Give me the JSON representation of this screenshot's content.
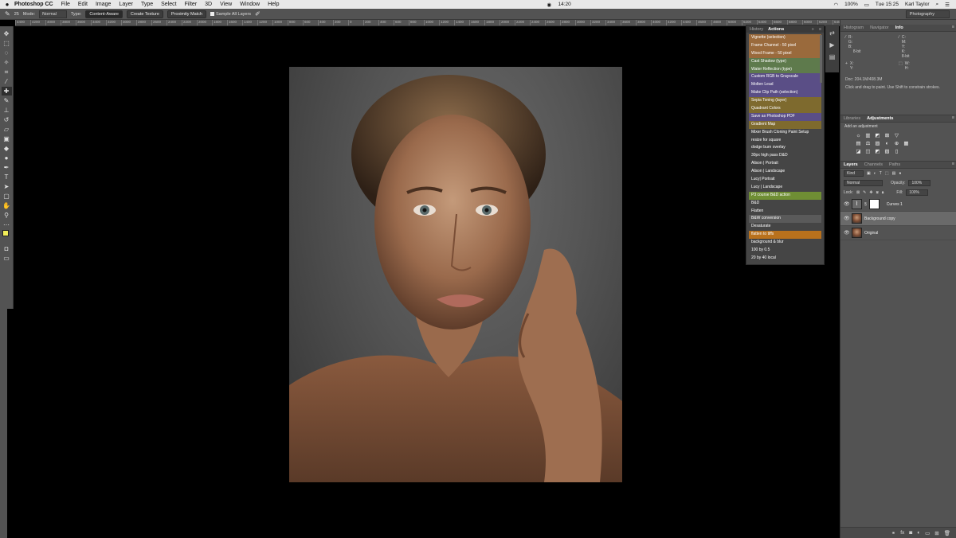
{
  "menubar": {
    "apple": "",
    "app_name": "Photoshop CC",
    "items": [
      "File",
      "Edit",
      "Image",
      "Layer",
      "Type",
      "Select",
      "Filter",
      "3D",
      "View",
      "Window",
      "Help"
    ],
    "time_center": "14:20",
    "battery": "100%",
    "clock": "Tue 15:25",
    "user": "Karl Taylor"
  },
  "options_bar": {
    "brush_size": "25",
    "mode_label": "Mode:",
    "mode_value": "Normal",
    "type_label": "Type:",
    "type_options": [
      "Content-Aware",
      "Create Texture",
      "Proximity Match"
    ],
    "sample_all_layers": "Sample All Layers",
    "workspace": "Photography"
  },
  "ruler": {
    "ticks": [
      "4400",
      "4200",
      "4000",
      "3800",
      "3600",
      "3400",
      "3200",
      "3000",
      "2800",
      "2600",
      "2400",
      "2200",
      "2000",
      "1800",
      "1600",
      "1400",
      "1200",
      "1000",
      "800",
      "600",
      "400",
      "200",
      "0",
      "200",
      "400",
      "600",
      "800",
      "1000",
      "1200",
      "1400",
      "1600",
      "1800",
      "2000",
      "2200",
      "2400",
      "2600",
      "2800",
      "3000",
      "3200",
      "3400",
      "3600",
      "3800",
      "4000",
      "4200",
      "4400",
      "4600",
      "4800",
      "5000",
      "5200",
      "5400",
      "5600",
      "5800",
      "6000",
      "6200",
      "6400",
      "6600",
      "6800",
      "7000",
      "7200"
    ]
  },
  "actions_panel": {
    "tabs": [
      "History",
      "Actions"
    ],
    "items": [
      {
        "label": "Vignette (selection)",
        "color": "#9a6a3c"
      },
      {
        "label": "Frame Channel - 50 pixel",
        "color": "#9a6a3c"
      },
      {
        "label": "Wood Frame - 50 pixel",
        "color": "#9a6a3c"
      },
      {
        "label": "Cast Shadow (type)",
        "color": "#5e7a4c"
      },
      {
        "label": "Water Reflection (type)",
        "color": "#5e7a4c"
      },
      {
        "label": "Custom RGB to Grayscale",
        "color": "#5a4e86"
      },
      {
        "label": "Molten Lead",
        "color": "#5a4e86"
      },
      {
        "label": "Make Clip Path (selection)",
        "color": "#5a4e86"
      },
      {
        "label": "Sepia Toning (layer)",
        "color": "#7e6a2e"
      },
      {
        "label": "Quadrant Colors",
        "color": "#7e6a2e"
      },
      {
        "label": "Save as Photoshop PDF",
        "color": "#5a4e86"
      },
      {
        "label": "Gradient Map",
        "color": "#7e6a2e"
      },
      {
        "label": "Mixer Brush Cloning Paint Setup",
        "color": "#454545"
      },
      {
        "label": "resize for square",
        "color": "#454545"
      },
      {
        "label": "dodge burn overlay",
        "color": "#454545"
      },
      {
        "label": "30px high pass D&D",
        "color": "#454545"
      },
      {
        "label": "Alison | Portrait",
        "color": "#454545"
      },
      {
        "label": "Alison | Landscape",
        "color": "#454545"
      },
      {
        "label": "Lucy| Portrait",
        "color": "#454545"
      },
      {
        "label": "Lucy | Landscape",
        "color": "#454545"
      },
      {
        "label": "P3 course B&D action",
        "color": "#6f8e34"
      },
      {
        "label": "B&D",
        "color": "#454545"
      },
      {
        "label": "Flatten",
        "color": "#454545"
      },
      {
        "label": "B&W conversion",
        "color": "#5a5a5a"
      },
      {
        "label": "Desaturate",
        "color": "#454545"
      },
      {
        "label": "flatten to tiffs",
        "color": "#b9711c"
      },
      {
        "label": "background & blur",
        "color": "#454545"
      },
      {
        "label": "100 by 0.5",
        "color": "#454545"
      },
      {
        "label": "20 by 40 local",
        "color": "#454545"
      }
    ]
  },
  "info_panel": {
    "tabs": [
      "Histogram",
      "Navigator",
      "Info"
    ],
    "r_label": "R:",
    "g_label": "G:",
    "b_label": "B:",
    "c_label": "C:",
    "m_label": "M:",
    "y_label": "Y:",
    "k_label": "K:",
    "bit_left": "8-bit",
    "bit_right": "8-bit",
    "x_label": "X:",
    "y2_label": "Y:",
    "w_label": "W:",
    "h_label": "H:",
    "doc": "Doc: 204.1M/408.3M",
    "hint": "Click and drag to paint. Use Shift to constrain strokes."
  },
  "adjustments_panel": {
    "tabs": [
      "Libraries",
      "Adjustments"
    ],
    "subtitle": "Add an adjustment",
    "row1": [
      "☼",
      "▥",
      "◩",
      "⊠",
      "▽"
    ],
    "row2": [
      "▤",
      "⚖",
      "▨",
      "◐",
      "⊕",
      "▦"
    ],
    "row3": [
      "◪",
      "◫",
      "◩",
      "▧",
      "▯"
    ]
  },
  "layers_panel": {
    "tabs": [
      "Layers",
      "Channels",
      "Paths"
    ],
    "kind": "Kind",
    "blend_mode": "Normal",
    "opacity_label": "Opacity:",
    "opacity_value": "100%",
    "lock_label": "Lock:",
    "fill_label": "Fill:",
    "fill_value": "100%",
    "layers": [
      {
        "name": "Curves 1",
        "type": "adjustment"
      },
      {
        "name": "Background copy",
        "type": "photo"
      },
      {
        "name": "Original",
        "type": "photo"
      }
    ],
    "footer_icons": [
      "link-icon",
      "fx-icon",
      "mask-icon",
      "adjustment-icon",
      "folder-icon",
      "new-layer-icon",
      "trash-icon"
    ]
  }
}
